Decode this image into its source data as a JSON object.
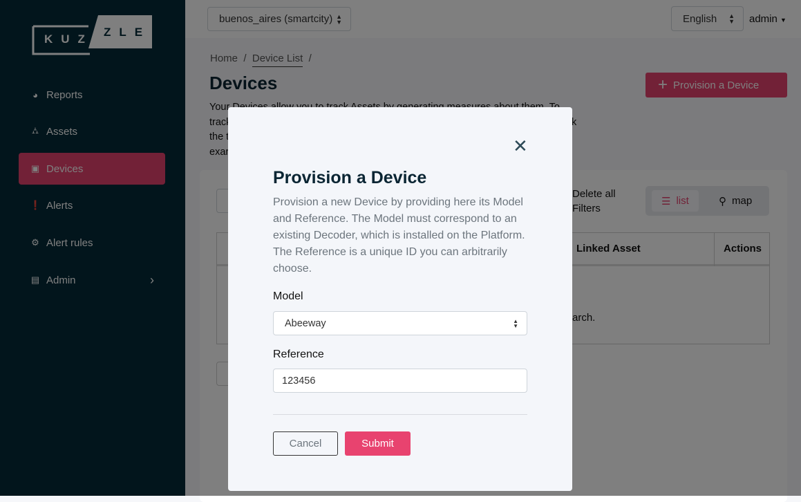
{
  "sidebar": {
    "logo_text": "KUZZLE",
    "items": [
      {
        "label": "Reports",
        "icon": "tachometer-icon"
      },
      {
        "label": "Assets",
        "icon": "sitemap-icon"
      },
      {
        "label": "Devices",
        "icon": "microchip-icon",
        "active": true
      },
      {
        "label": "Alerts",
        "icon": "exclamation-circle-icon"
      },
      {
        "label": "Alert rules",
        "icon": "cogs-icon"
      },
      {
        "label": "Admin",
        "icon": "toolbox-icon"
      }
    ]
  },
  "topbar": {
    "tenant": "buenos_aires (smartcity)",
    "language": "English",
    "user": "admin"
  },
  "breadcrumb": {
    "home": "Home",
    "current": "Device List",
    "sep": "/"
  },
  "page": {
    "title": "Devices",
    "intro_line1": "Your Devices allow you to track Assets by generating measures about them. To",
    "intro_line2a": "track",
    "intro_line2b": "k",
    "intro_line3": "the t",
    "intro_line4": "exar",
    "provision_button": "Provision a Device"
  },
  "toolbar": {
    "delete_filters": "Delete all Filters",
    "view_list": "list",
    "view_map": "map"
  },
  "table": {
    "headers": [
      "Linked Asset",
      "Actions"
    ],
    "empty_fragment": "arch."
  },
  "modal": {
    "title": "Provision a Device",
    "description": "Provision a new Device by providing here its Model and Reference. The Model must correspond to an existing Decoder, which is installed on the Platform. The Reference is a unique ID you can arbitrarily choose.",
    "model_label": "Model",
    "model_value": "Abeeway",
    "reference_label": "Reference",
    "reference_value": "123456",
    "cancel": "Cancel",
    "submit": "Submit"
  },
  "colors": {
    "accent": "#e8436f",
    "sidebar": "#042a38"
  }
}
